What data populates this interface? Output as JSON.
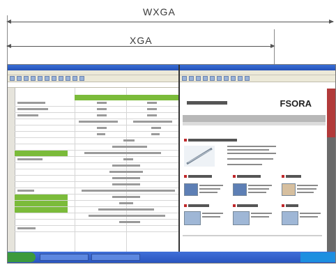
{
  "dimensions": {
    "wxga_label": "WXGA",
    "xga_label": "XGA"
  },
  "right_window": {
    "site_logo": "FSORA"
  },
  "colors": {
    "spreadsheet_highlight": "#7bbb3a",
    "browser_accent": "#c0282b",
    "taskbar": "#2a55c0",
    "window_title": "#2350b8"
  }
}
